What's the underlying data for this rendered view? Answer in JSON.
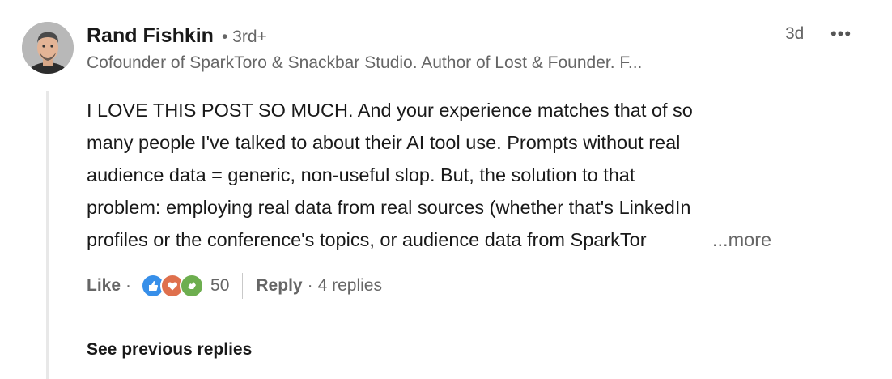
{
  "author": {
    "name": "Rand Fishkin",
    "degree": "3rd+",
    "headline": "Cofounder of SparkToro & Snackbar Studio. Author of Lost & Founder. F...",
    "time": "3d"
  },
  "comment": {
    "lines": [
      "I LOVE THIS POST SO MUCH. And your experience matches that of so",
      "many people I've talked to about their AI tool use. Prompts without real",
      "audience data = generic, non-useful slop. But, the solution to that",
      "problem: employing real data from real sources (whether that's LinkedIn",
      "profiles or the conference's topics, or audience data from SparkTor"
    ],
    "see_more": "...more"
  },
  "actions": {
    "like_label": "Like",
    "reaction_count": "50",
    "reply_label": "Reply",
    "replies_count": "4 replies",
    "reactions": [
      "like-icon",
      "love-icon",
      "support-icon"
    ]
  },
  "thread": {
    "see_previous_label": "See previous replies"
  },
  "colors": {
    "like": "#378fe9",
    "love": "#df704d",
    "support": "#6dae4f",
    "thread_line": "#e8e8e8"
  }
}
